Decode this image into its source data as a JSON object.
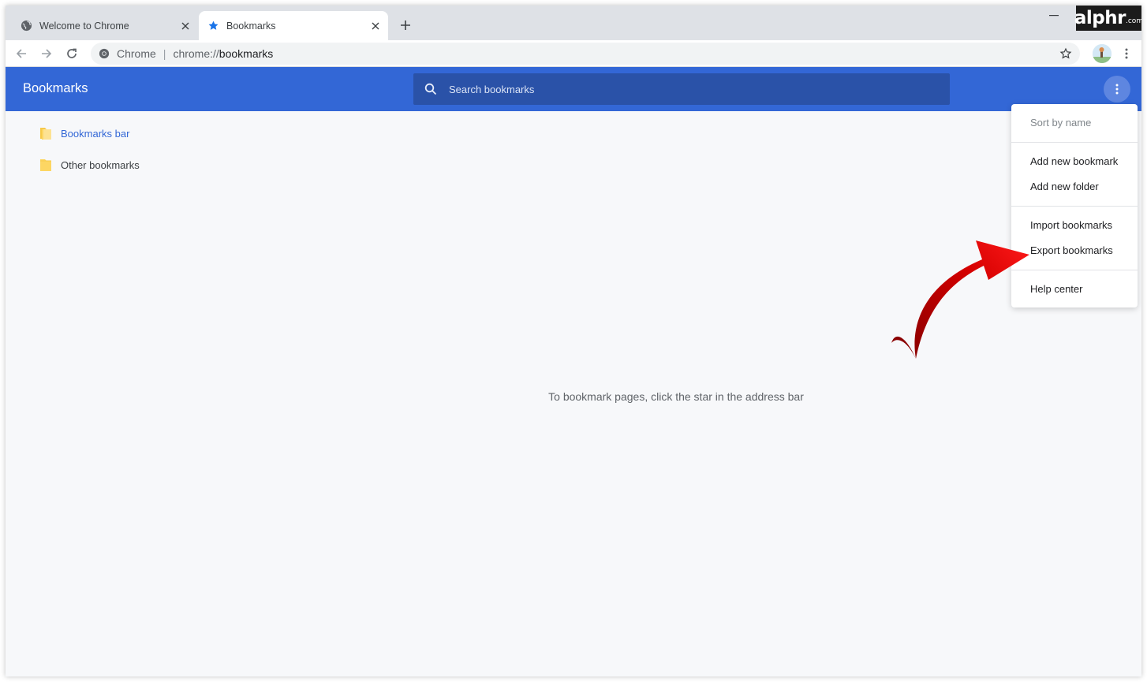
{
  "tabs": [
    {
      "title": "Welcome to Chrome",
      "favicon": "globe-icon",
      "active": false
    },
    {
      "title": "Bookmarks",
      "favicon": "star-icon",
      "active": true
    }
  ],
  "brand": {
    "logo": "alphr",
    "logo_suffix": ".com"
  },
  "toolbar": {
    "omnibox_label": "Chrome",
    "url_scheme": "chrome://",
    "url_path": "bookmarks"
  },
  "header": {
    "title": "Bookmarks",
    "search_placeholder": "Search bookmarks"
  },
  "sidebar": {
    "folders": [
      {
        "label": "Bookmarks bar",
        "selected": true
      },
      {
        "label": "Other bookmarks",
        "selected": false
      }
    ]
  },
  "main": {
    "empty_message": "To bookmark pages, click the star in the address bar"
  },
  "menu": {
    "items": [
      {
        "label": "Sort by name",
        "enabled": false
      },
      {
        "label": "Add new bookmark",
        "enabled": true
      },
      {
        "label": "Add new folder",
        "enabled": true
      },
      {
        "label": "Import bookmarks",
        "enabled": true
      },
      {
        "label": "Export bookmarks",
        "enabled": true
      },
      {
        "label": "Help center",
        "enabled": true
      }
    ]
  },
  "colors": {
    "header_bg": "#3367d6",
    "search_bg": "#2a52a8",
    "folder_yellow": "#fdd663",
    "annotation_arrow": "#cc0000"
  }
}
